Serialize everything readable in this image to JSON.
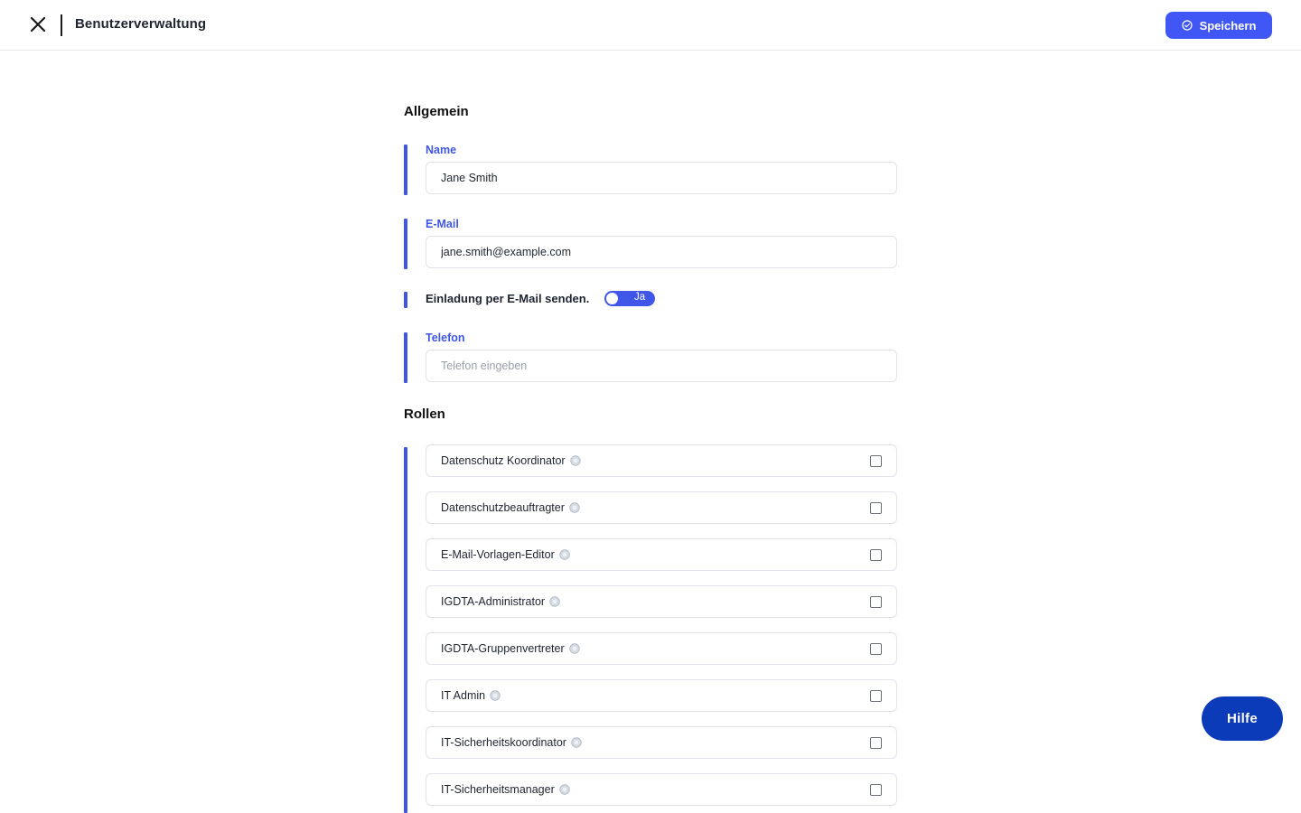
{
  "header": {
    "title": "Benutzerverwaltung",
    "close_icon": "close-icon",
    "save_label": "Speichern",
    "save_icon": "check-circle-icon",
    "accent_color": "#4057f5"
  },
  "sections": {
    "general_title": "Allgemein",
    "roles_title": "Rollen"
  },
  "fields": {
    "name": {
      "label": "Name",
      "value": "Jane Smith"
    },
    "email": {
      "label": "E-Mail",
      "value": "jane.smith@example.com"
    },
    "invite": {
      "label": "Einladung per E-Mail senden.",
      "toggle_text": "Ja",
      "enabled": true
    },
    "phone": {
      "label": "Telefon",
      "value": "",
      "placeholder": "Telefon eingeben"
    }
  },
  "roles": [
    {
      "label": "Datenschutz Koordinator",
      "checked": false
    },
    {
      "label": "Datenschutzbeauftragter",
      "checked": false
    },
    {
      "label": "E-Mail-Vorlagen-Editor",
      "checked": false
    },
    {
      "label": "IGDTA-Administrator",
      "checked": false
    },
    {
      "label": "IGDTA-Gruppenvertreter",
      "checked": false
    },
    {
      "label": "IT Admin",
      "checked": false
    },
    {
      "label": "IT-Sicherheitskoordinator",
      "checked": false
    },
    {
      "label": "IT-Sicherheitsmanager",
      "checked": false
    }
  ],
  "help": {
    "label": "Hilfe",
    "color": "#0b3bb8"
  }
}
